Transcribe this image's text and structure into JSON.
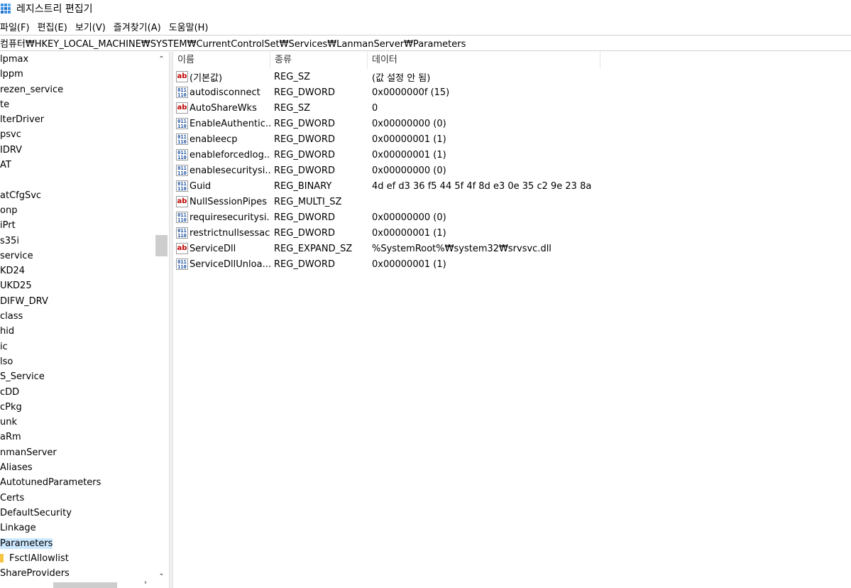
{
  "window": {
    "title": "레지스트리 편집기"
  },
  "menu": [
    "파일(F)",
    "편집(E)",
    "보기(V)",
    "즐겨찾기(A)",
    "도움말(H)"
  ],
  "address": "컴퓨터₩HKEY_LOCAL_MACHINE₩SYSTEM₩CurrentControlSet₩Services₩LanmanServer₩Parameters",
  "tree": {
    "items": [
      {
        "label": "lpmax"
      },
      {
        "label": "lppm"
      },
      {
        "label": "rezen_service"
      },
      {
        "label": "te"
      },
      {
        "label": "lterDriver"
      },
      {
        "label": "psvc"
      },
      {
        "label": "IDRV"
      },
      {
        "label": "AT"
      },
      {
        "label": ""
      },
      {
        "label": "atCfgSvc"
      },
      {
        "label": "onp"
      },
      {
        "label": "iPrt"
      },
      {
        "label": "s35i"
      },
      {
        "label": "service"
      },
      {
        "label": "KD24"
      },
      {
        "label": "UKD25"
      },
      {
        "label": "DIFW_DRV"
      },
      {
        "label": "class"
      },
      {
        "label": "hid"
      },
      {
        "label": "ic"
      },
      {
        "label": "lso"
      },
      {
        "label": "S_Service"
      },
      {
        "label": "cDD"
      },
      {
        "label": "cPkg"
      },
      {
        "label": "unk"
      },
      {
        "label": "aRm"
      },
      {
        "label": "nmanServer"
      },
      {
        "label": "Aliases"
      },
      {
        "label": "AutotunedParameters"
      },
      {
        "label": "Certs"
      },
      {
        "label": "DefaultSecurity"
      },
      {
        "label": "Linkage"
      },
      {
        "label": "Parameters"
      },
      {
        "label": "FsctlAllowlist"
      },
      {
        "label": "ShareProviders"
      }
    ]
  },
  "list": {
    "columns": {
      "name": "이름",
      "type": "종류",
      "data": "데이터"
    },
    "rows": [
      {
        "icon": "string-value-icon",
        "name": "(기본값)",
        "type": "REG_SZ",
        "data": "(값 설정 안 됨)"
      },
      {
        "icon": "binary-value-icon",
        "name": "autodisconnect",
        "type": "REG_DWORD",
        "data": "0x0000000f (15)"
      },
      {
        "icon": "string-value-icon",
        "name": "AutoShareWks",
        "type": "REG_SZ",
        "data": "0"
      },
      {
        "icon": "binary-value-icon",
        "name": "EnableAuthentic...",
        "type": "REG_DWORD",
        "data": "0x00000000 (0)"
      },
      {
        "icon": "binary-value-icon",
        "name": "enableecp",
        "type": "REG_DWORD",
        "data": "0x00000001 (1)"
      },
      {
        "icon": "binary-value-icon",
        "name": "enableforcedlog...",
        "type": "REG_DWORD",
        "data": "0x00000001 (1)"
      },
      {
        "icon": "binary-value-icon",
        "name": "enablesecuritysi...",
        "type": "REG_DWORD",
        "data": "0x00000000 (0)"
      },
      {
        "icon": "binary-value-icon",
        "name": "Guid",
        "type": "REG_BINARY",
        "data": "4d ef d3 36 f5 44 5f 4f 8d e3 0e 35 c2 9e 23 8a"
      },
      {
        "icon": "string-value-icon",
        "name": "NullSessionPipes",
        "type": "REG_MULTI_SZ",
        "data": ""
      },
      {
        "icon": "binary-value-icon",
        "name": "requiresecuritysi...",
        "type": "REG_DWORD",
        "data": "0x00000000 (0)"
      },
      {
        "icon": "binary-value-icon",
        "name": "restrictnullsessac...",
        "type": "REG_DWORD",
        "data": "0x00000001 (1)"
      },
      {
        "icon": "string-value-icon",
        "name": "ServiceDll",
        "type": "REG_EXPAND_SZ",
        "data": "%SystemRoot%₩system32₩srvsvc.dll"
      },
      {
        "icon": "binary-value-icon",
        "name": "ServiceDllUnloa...",
        "type": "REG_DWORD",
        "data": "0x00000001 (1)"
      }
    ]
  },
  "colors": {
    "selection": "#cce8ff",
    "accent": "#0063b1",
    "string_icon": "#c00000",
    "binary_icon": "#1a4fa0"
  }
}
